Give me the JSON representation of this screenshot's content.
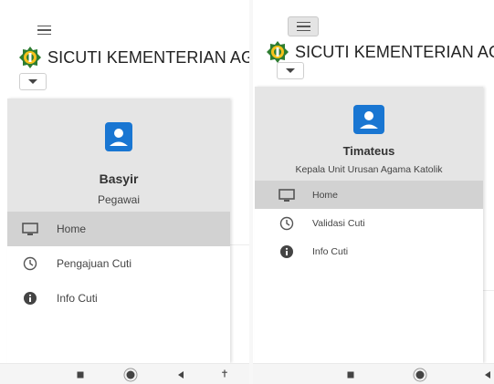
{
  "brand": {
    "title": "SICUTI KEMENTERIAN AGAMA"
  },
  "colors": {
    "accent": "#1976d2",
    "drawer_header": "#e5e5e5",
    "active_item": "#d2d2d2"
  },
  "left_screen": {
    "user": {
      "name": "Basyir",
      "role": "Pegawai"
    },
    "menu": [
      {
        "label": "Home",
        "icon": "monitor-icon",
        "active": true
      },
      {
        "label": "Pengajuan Cuti",
        "icon": "clock-icon",
        "active": false
      },
      {
        "label": "Info Cuti",
        "icon": "info-icon",
        "active": false
      }
    ]
  },
  "right_screen": {
    "user": {
      "name": "Timateus",
      "role": "Kepala Unit Urusan Agama Katolik"
    },
    "menu": [
      {
        "label": "Home",
        "icon": "monitor-icon",
        "active": true
      },
      {
        "label": "Validasi Cuti",
        "icon": "clock-icon",
        "active": false
      },
      {
        "label": "Info Cuti",
        "icon": "info-icon",
        "active": false
      }
    ]
  },
  "nav_icons": [
    "recent-apps-icon",
    "home-icon",
    "back-icon",
    "accessibility-icon"
  ]
}
